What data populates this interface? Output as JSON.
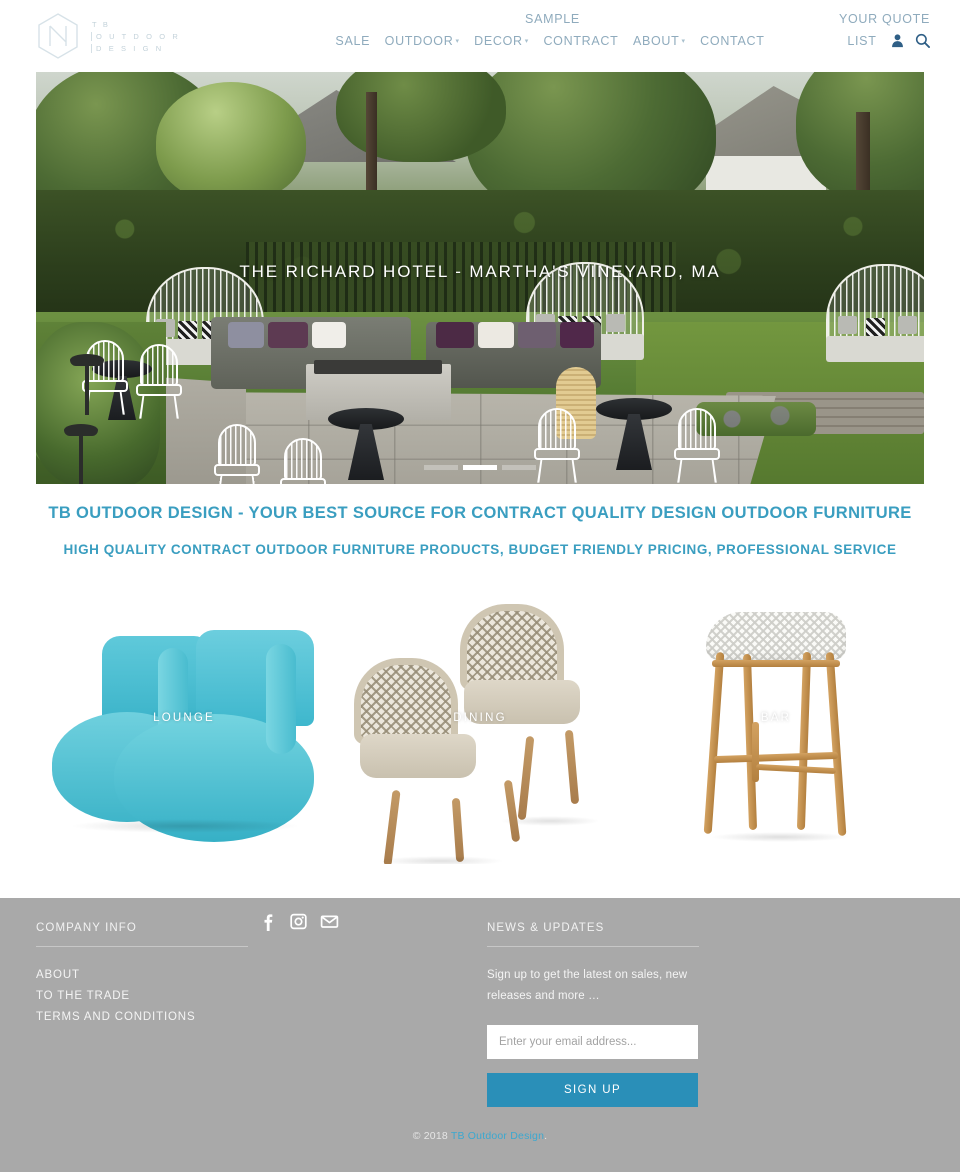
{
  "header": {
    "logo": {
      "line1": "T B",
      "line2": "O U T D O O R",
      "line3": "D E S I G N",
      "icon": "hexagon-logo-icon"
    },
    "nav_top": [
      {
        "label": "SAMPLE",
        "has_caret": false
      }
    ],
    "nav_items": [
      {
        "label": "SALE",
        "has_caret": false
      },
      {
        "label": "OUTDOOR",
        "has_caret": true
      },
      {
        "label": "DECOR",
        "has_caret": true
      },
      {
        "label": "CONTRACT",
        "has_caret": false
      },
      {
        "label": "ABOUT",
        "has_caret": true
      },
      {
        "label": "CONTACT",
        "has_caret": false
      }
    ],
    "quote_line1": "YOUR QUOTE",
    "quote_line2": "LIST",
    "account_icon": "user-icon",
    "search_icon": "search-icon",
    "caret_glyph": "▾"
  },
  "hero": {
    "caption": "THE RICHARD HOTEL - MARTHA'S VINEYARD, MA",
    "slides_total": 3,
    "active_slide": 2
  },
  "headlines": {
    "primary": "TB OUTDOOR DESIGN - YOUR BEST SOURCE FOR CONTRACT QUALITY DESIGN OUTDOOR FURNITURE",
    "secondary": "HIGH QUALITY CONTRACT OUTDOOR FURNITURE PRODUCTS, BUDGET FRIENDLY PRICING, PROFESSIONAL SERVICE"
  },
  "categories": [
    {
      "label": "LOUNGE",
      "art": "turquoise-curved-lounge-sofa"
    },
    {
      "label": "DINING",
      "art": "woven-rope-dining-armchairs"
    },
    {
      "label": "BAR",
      "art": "teak-woven-bar-stool"
    }
  ],
  "footer": {
    "company_heading": "COMPANY INFO",
    "company_links": [
      {
        "label": "ABOUT"
      },
      {
        "label": "TO THE TRADE"
      },
      {
        "label": "TERMS AND CONDITIONS"
      }
    ],
    "social": [
      {
        "name": "facebook-icon"
      },
      {
        "name": "instagram-icon"
      },
      {
        "name": "email-icon"
      }
    ],
    "news_heading": "NEWS & UPDATES",
    "news_copy": "Sign up to get the latest on sales, new releases and more …",
    "email_placeholder": "Enter your email address...",
    "signup_label": "SIGN UP",
    "copyright_prefix": "© 2018 ",
    "copyright_link": "TB Outdoor Design",
    "copyright_suffix": "."
  },
  "colors": {
    "accent_teal": "#3a9ec0",
    "button_teal": "#2a8fb8",
    "nav_blue": "#8fabbd",
    "footer_gray": "#a9a9a9"
  }
}
